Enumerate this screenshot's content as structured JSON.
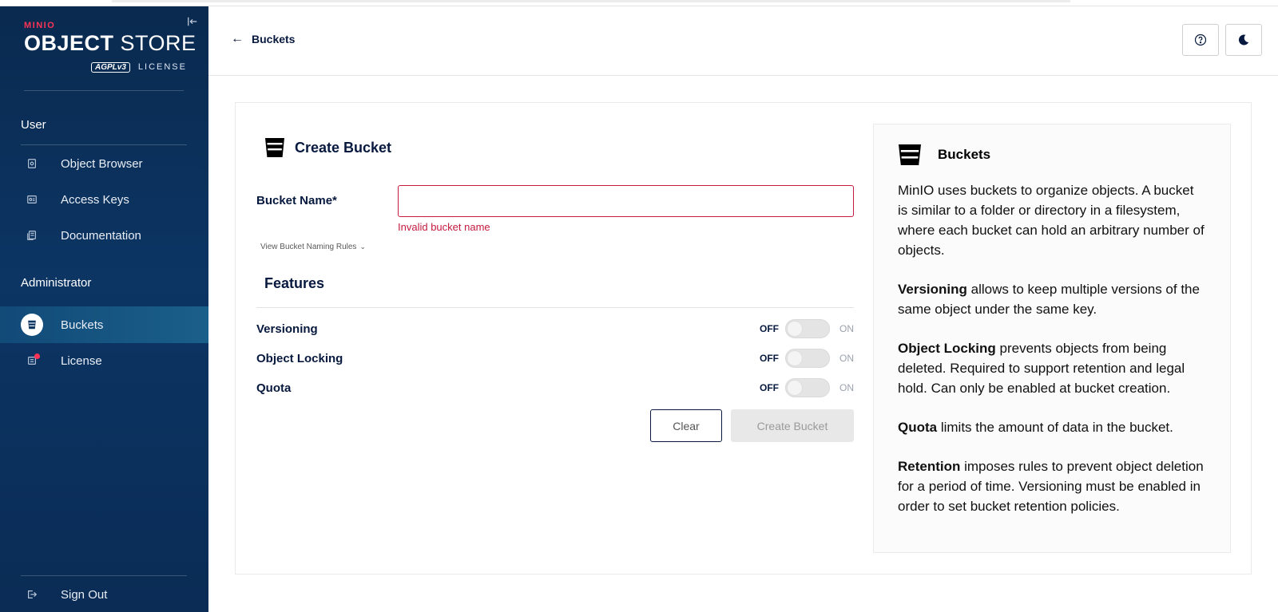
{
  "brand": {
    "minio": "MINIO",
    "store_bold": "OBJECT",
    "store_light": " STORE",
    "agpl": "AGPLv3",
    "license": "LICENSE"
  },
  "sidebar": {
    "user_section": "User",
    "admin_section": "Administrator",
    "user_items": [
      {
        "label": "Object Browser",
        "icon": "object-browser-icon"
      },
      {
        "label": "Access Keys",
        "icon": "access-keys-icon"
      },
      {
        "label": "Documentation",
        "icon": "documentation-icon"
      }
    ],
    "admin_items": [
      {
        "label": "Buckets",
        "icon": "bucket-icon",
        "active": true
      },
      {
        "label": "License",
        "icon": "license-icon",
        "notification": true
      }
    ],
    "sign_out": "Sign Out"
  },
  "header": {
    "back_label": "Buckets"
  },
  "form": {
    "title": "Create Bucket",
    "bucket_name_label": "Bucket Name*",
    "bucket_name_value": "",
    "bucket_name_error": "Invalid bucket name",
    "naming_rules_link": "View Bucket Naming Rules",
    "features_title": "Features",
    "features": [
      {
        "name": "Versioning",
        "off": "OFF",
        "on": "ON",
        "enabled": false
      },
      {
        "name": "Object Locking",
        "off": "OFF",
        "on": "ON",
        "enabled": false
      },
      {
        "name": "Quota",
        "off": "OFF",
        "on": "ON",
        "enabled": false
      }
    ],
    "clear_label": "Clear",
    "create_label": "Create Bucket"
  },
  "help": {
    "title": "Buckets",
    "intro": "MinIO uses buckets to organize objects. A bucket is similar to a folder or directory in a filesystem, where each bucket can hold an arbitrary number of objects.",
    "items": [
      {
        "term": "Versioning",
        "text": " allows to keep multiple versions of the same object under the same key."
      },
      {
        "term": "Object Locking",
        "text": " prevents objects from being deleted. Required to support retention and legal hold. Can only be enabled at bucket creation."
      },
      {
        "term": "Quota",
        "text": " limits the amount of data in the bucket."
      },
      {
        "term": "Retention",
        "text": " imposes rules to prevent object deletion for a period of time. Versioning must be enabled in order to set bucket retention policies."
      }
    ]
  },
  "colors": {
    "sidebar_bg": "#0c3564",
    "accent_error": "#c51b3f",
    "brand_red": "#ff3355",
    "text_dark": "#07193e"
  }
}
